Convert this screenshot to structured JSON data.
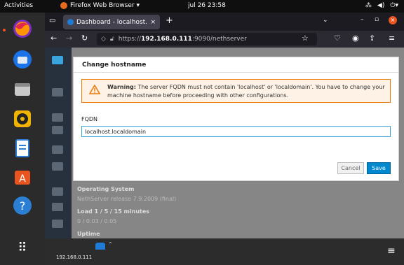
{
  "topbar": {
    "activities": "Activities",
    "app_name": "Firefox Web Browser ▾",
    "clock": "jul 26  23:58"
  },
  "browser": {
    "tab_title": "Dashboard - localhost.loc",
    "tab_close": "×",
    "new_tab": "+",
    "url_prefix": "https://",
    "url_host": "192.168.0.111",
    "url_rest": ":9090/nethserver"
  },
  "modal": {
    "title": "Change hostname",
    "warning_bold": "Warning:",
    "warning_text": "The server FQDN must not contain 'localhost' or 'localdomain'. You have to change your machine hostname before proceeding with other configurations.",
    "fqdn_label": "FQDN",
    "fqdn_value": "localhost.localdomain",
    "cancel_label": "Cancel",
    "save_label": "Save"
  },
  "background": {
    "os_heading": "Operating System",
    "os_value": "NethServer release 7.9.2009 (final)",
    "load_heading": "Load 1 / 5 / 15 minutes",
    "load_value": "0 / 0.03 / 0.05",
    "uptime_heading": "Uptime"
  },
  "bottom": {
    "host": "192.168.0.111"
  },
  "colors": {
    "accent": "#0088ce",
    "warning": "#ec7a08",
    "ubuntu_orange": "#e95420"
  }
}
